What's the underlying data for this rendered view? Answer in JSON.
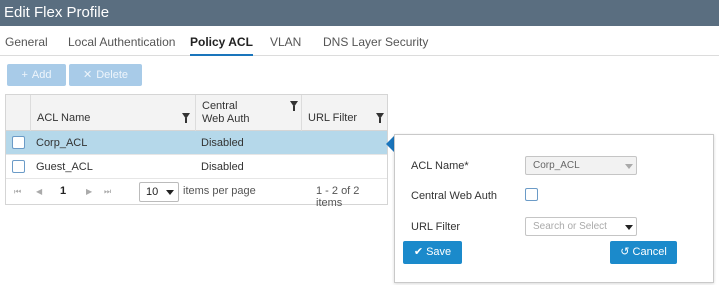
{
  "header": {
    "title": "Edit Flex Profile"
  },
  "tabs": [
    {
      "label": "General",
      "active": false
    },
    {
      "label": "Local Authentication",
      "active": false
    },
    {
      "label": "Policy ACL",
      "active": true
    },
    {
      "label": "VLAN",
      "active": false
    },
    {
      "label": "DNS Layer Security",
      "active": false
    }
  ],
  "toolbar": {
    "add_label": "Add",
    "delete_label": "Delete",
    "add_icon": "plus-icon",
    "delete_icon": "x-icon"
  },
  "table": {
    "columns": [
      "ACL Name",
      "Central Web Auth",
      "URL Filter"
    ],
    "rows": [
      {
        "acl_name": "Corp_ACL",
        "central_web_auth": "Disabled",
        "selected": true
      },
      {
        "acl_name": "Guest_ACL",
        "central_web_auth": "Disabled",
        "selected": false
      }
    ],
    "pager": {
      "first": "⏮",
      "prev": "◀",
      "page": "1",
      "next": "▶",
      "last": "⏭",
      "per_page": "10",
      "per_page_label": "items per page",
      "range": "1 - 2 of 2 items"
    }
  },
  "form": {
    "acl_name_label": "ACL Name*",
    "acl_name_value": "Corp_ACL",
    "cwa_label": "Central Web Auth",
    "url_filter_label": "URL Filter",
    "url_filter_placeholder": "Search or Select",
    "save_label": "Save",
    "cancel_label": "Cancel",
    "save_icon": "check-icon",
    "cancel_icon": "undo-icon"
  },
  "colors": {
    "titlebar": "#5a6e80",
    "accent": "#1a75bc",
    "button": "#1b8acb",
    "selected_row": "#b5d8ea"
  }
}
